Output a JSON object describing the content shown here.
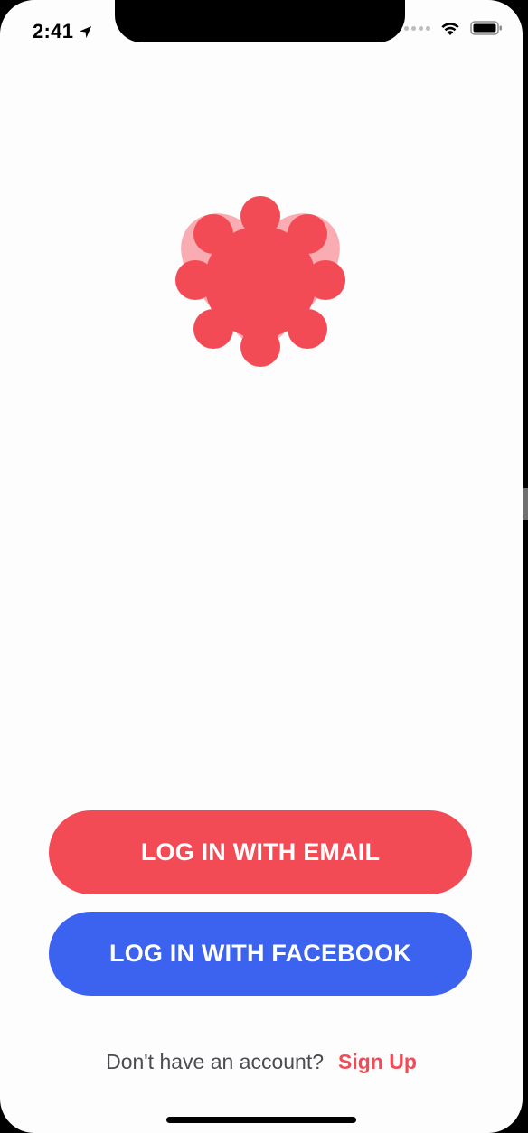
{
  "status_bar": {
    "time": "2:41",
    "icons": [
      "location-arrow-icon",
      "cellular-dots-icon",
      "wifi-icon",
      "battery-icon"
    ]
  },
  "logo": {
    "icon": "tinder-style-flame-logo",
    "color": "#f34b56"
  },
  "actions": {
    "email_label": "LOG IN WITH EMAIL",
    "email_color": "#f34b56",
    "facebook_label": "LOG IN WITH FACEBOOK",
    "facebook_color": "#3b63f0"
  },
  "footer": {
    "question": "Don't have an account?",
    "signup_label": "Sign Up"
  }
}
